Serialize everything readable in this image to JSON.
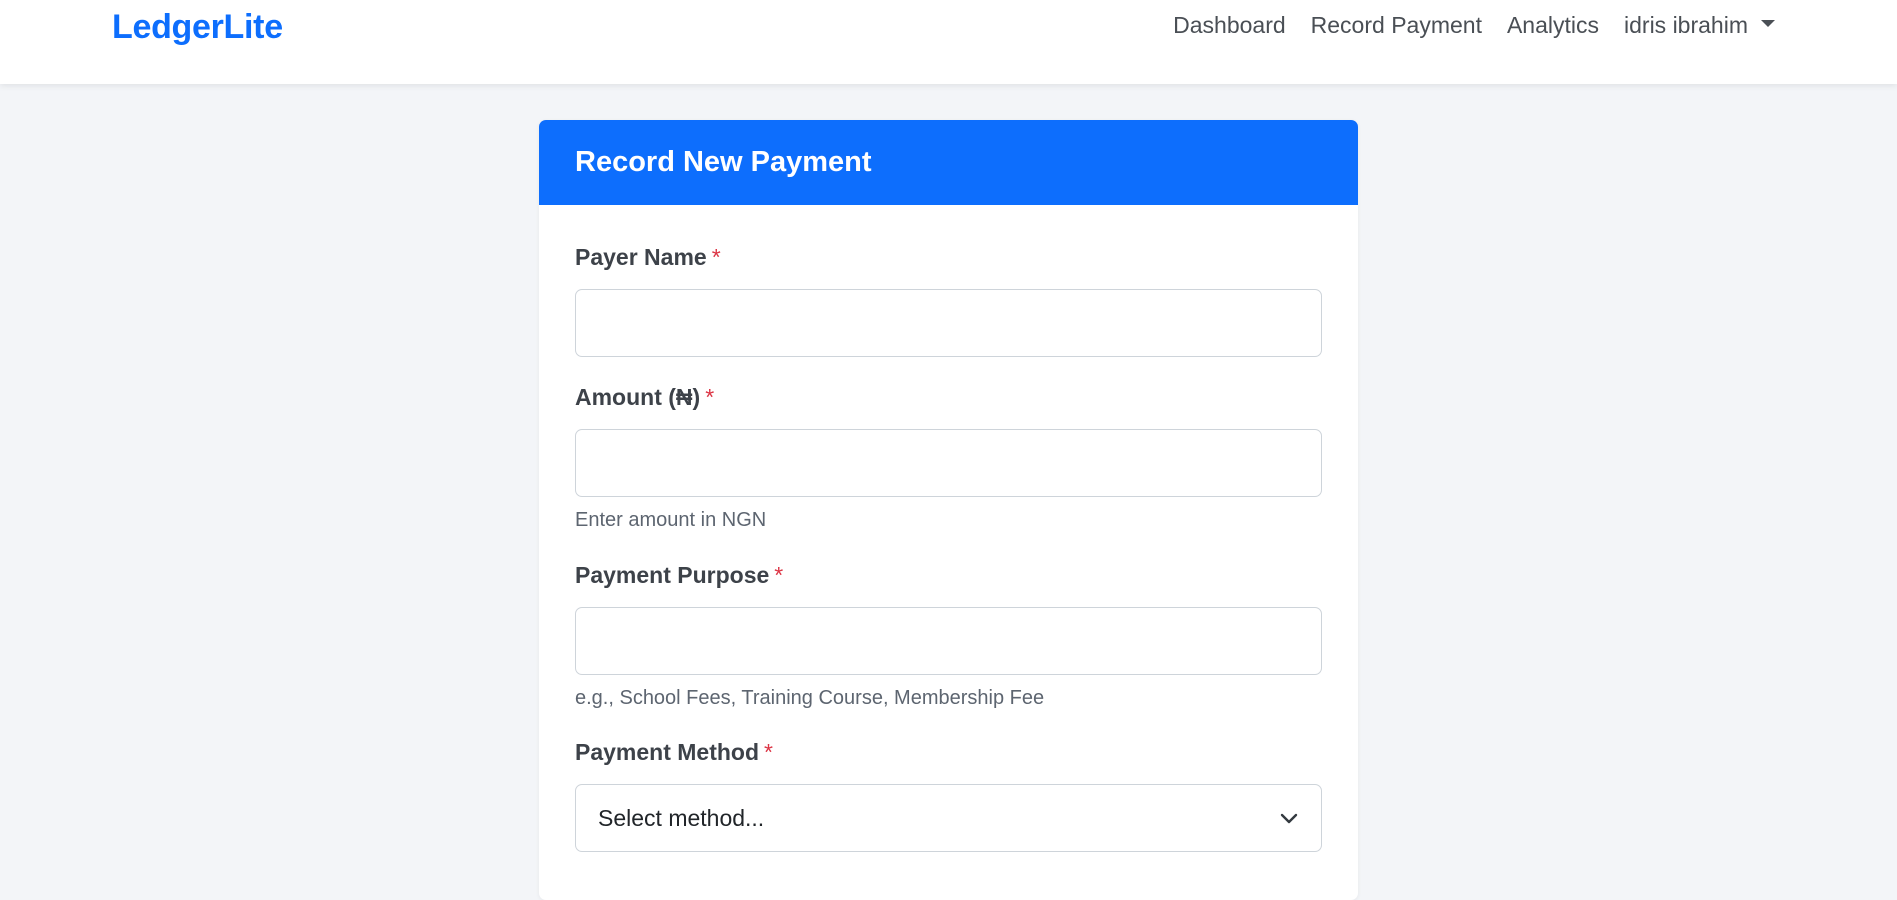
{
  "navbar": {
    "brand": "LedgerLite",
    "links": [
      "Dashboard",
      "Record Payment",
      "Analytics"
    ],
    "user_name": "idris ibrahim"
  },
  "form": {
    "title": "Record New Payment",
    "required_marker": "*",
    "payer_name": {
      "label": "Payer Name",
      "value": "",
      "placeholder": ""
    },
    "amount": {
      "label": "Amount (₦)",
      "value": "",
      "placeholder": "",
      "help": "Enter amount in NGN"
    },
    "purpose": {
      "label": "Payment Purpose",
      "value": "",
      "placeholder": "",
      "help": "e.g., School Fees, Training Course, Membership Fee"
    },
    "method": {
      "label": "Payment Method",
      "selected": "Select method..."
    }
  },
  "colors": {
    "brand": "#0d6efd",
    "required": "#dc3545",
    "page_background": "#f3f5f8"
  },
  "icons": {
    "user_menu": "caret-down-icon",
    "select": "chevron-down-icon"
  }
}
